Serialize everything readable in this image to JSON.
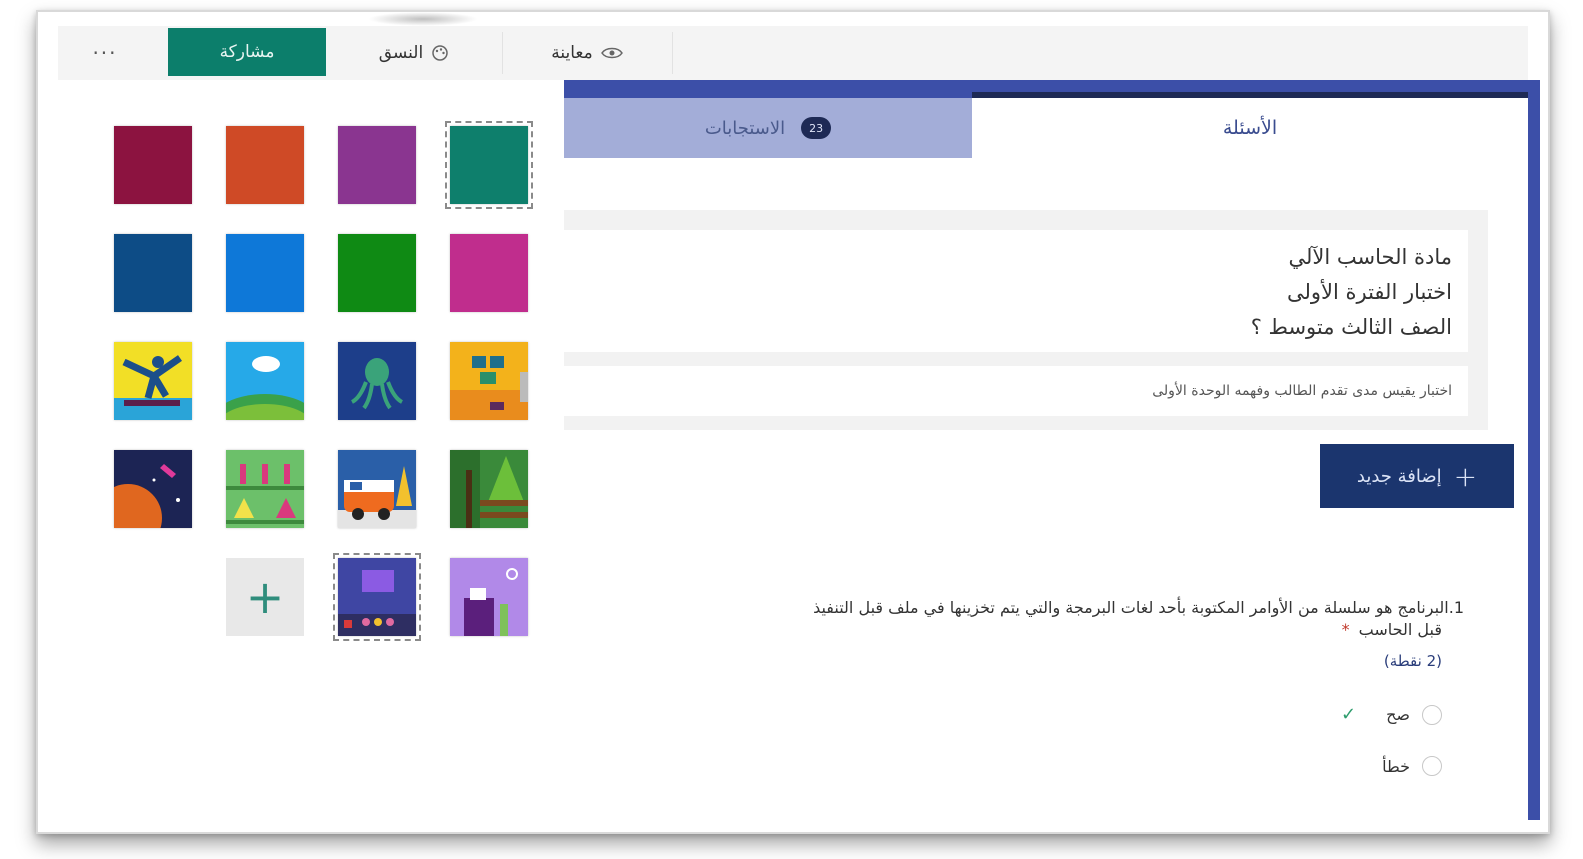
{
  "toolbar": {
    "more_label": "···",
    "share_label": "مشاركة",
    "theme_label": "النسق",
    "preview_label": "معاينة"
  },
  "tabs": {
    "questions_label": "الأسئلة",
    "responses_label": "الاستجابات",
    "responses_count": "23"
  },
  "form": {
    "title_lines": [
      "مادة الحاسب الآلي",
      "اختبار الفترة الأولى",
      "الصف الثالث متوسط ؟"
    ],
    "description": "اختبار يقيس مدى تقدم الطالب وفهمه الوحدة الأولى",
    "add_new_label": "إضافة جديد",
    "question": {
      "text": "1.البرنامج هو سلسلة من الأوامر المكتوبة بأحد لغات البرمجة والتي يتم تخزينها في ملف قبل التنفيذ",
      "text_line2": "قبل الحاسب",
      "required_mark": "*",
      "points": "(2 نقطة)",
      "options": [
        "صح",
        "خطأ"
      ]
    }
  },
  "colors": {
    "share_green": "#0c7e6b",
    "form_blue": "#3c4fa8",
    "button_navy": "#1b356e",
    "swatches": [
      "#0e7f6c",
      "#8a3590",
      "#cf4a26",
      "#8c1340",
      "#c02d8d",
      "#0f8a14",
      "#0e78d8",
      "#0d4c86"
    ]
  }
}
